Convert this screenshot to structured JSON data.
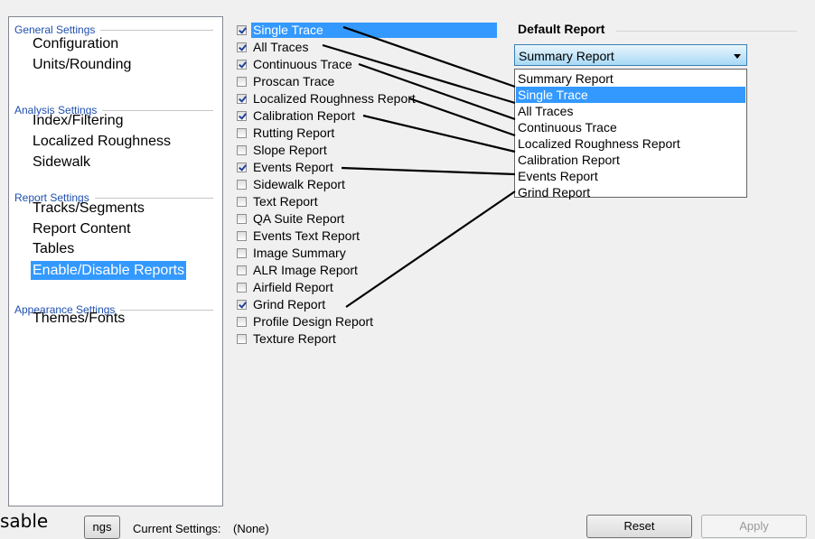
{
  "nav": {
    "groups": [
      {
        "header": "General Settings",
        "items": [
          "Configuration",
          "Units/Rounding"
        ]
      },
      {
        "header": "Analysis Settings",
        "items": [
          "Index/Filtering",
          "Localized Roughness",
          "Sidewalk"
        ]
      },
      {
        "header": "Report Settings",
        "items": [
          "Tracks/Segments",
          "Report Content",
          "Tables",
          "Enable/Disable Reports"
        ]
      },
      {
        "header": "Appearance Settings",
        "items": [
          "Themes/Fonts"
        ]
      }
    ],
    "selected": "Enable/Disable Reports"
  },
  "reports": [
    {
      "label": "Single Trace",
      "checked": true,
      "highlighted": true
    },
    {
      "label": "All Traces",
      "checked": true
    },
    {
      "label": "Continuous Trace",
      "checked": true
    },
    {
      "label": "Proscan Trace",
      "checked": false
    },
    {
      "label": "Localized Roughness Report",
      "checked": true
    },
    {
      "label": "Calibration Report",
      "checked": true
    },
    {
      "label": "Rutting Report",
      "checked": false
    },
    {
      "label": "Slope Report",
      "checked": false
    },
    {
      "label": "Events Report",
      "checked": true
    },
    {
      "label": "Sidewalk Report",
      "checked": false
    },
    {
      "label": "Text Report",
      "checked": false
    },
    {
      "label": "QA Suite Report",
      "checked": false
    },
    {
      "label": "Events Text Report",
      "checked": false
    },
    {
      "label": "Image Summary",
      "checked": false
    },
    {
      "label": "ALR Image Report",
      "checked": false
    },
    {
      "label": "Airfield Report",
      "checked": false
    },
    {
      "label": "Grind Report",
      "checked": true
    },
    {
      "label": "Profile Design Report",
      "checked": false
    },
    {
      "label": "Texture Report",
      "checked": false
    }
  ],
  "default_report": {
    "title": "Default Report",
    "value": "Summary Report",
    "options": [
      "Summary Report",
      "Single Trace",
      "All Traces",
      "Continuous Trace",
      "Localized Roughness Report",
      "Calibration Report",
      "Events Report",
      "Grind Report"
    ],
    "highlighted_option": "Single Trace"
  },
  "bottom": {
    "cropped_text": "sable",
    "cropped_button": "ngs",
    "current_settings_label": "Current Settings:",
    "current_settings_value": "(None)",
    "reset_label": "Reset",
    "apply_label": "Apply"
  }
}
